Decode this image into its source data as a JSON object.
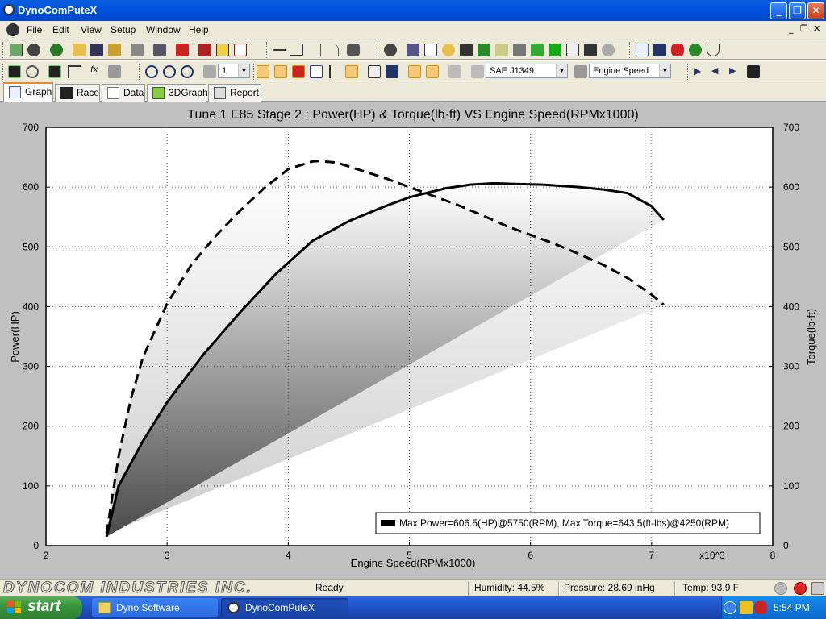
{
  "window": {
    "title": "DynoComPuteX"
  },
  "menu": {
    "items": [
      "File",
      "Edit",
      "View",
      "Setup",
      "Window",
      "Help"
    ]
  },
  "toolbar2": {
    "zoom_value": "1",
    "standard": "SAE J1349",
    "x_axis": "Engine Speed"
  },
  "tabs": [
    {
      "label": "Graph"
    },
    {
      "label": "Race"
    },
    {
      "label": "Data"
    },
    {
      "label": "3DGraph"
    },
    {
      "label": "Report"
    }
  ],
  "colors": {
    "titlebar": "#0054e3",
    "taskbar": "#245edb",
    "start": "#3c963c",
    "graph_bg": "#c0c0c0",
    "plot_bg": "#ffffff"
  },
  "chart_data": {
    "type": "line",
    "title": "Tune 1 E85 Stage 2 : Power(HP) & Torque(lb·ft) VS Engine Speed(RPMx1000)",
    "xlabel": "Engine Speed(RPMx1000)",
    "ylabel_left": "Power(HP)",
    "ylabel_right": "Torque(lb·ft)",
    "x_multiplier_label": "x10^3",
    "xlim": [
      2,
      8
    ],
    "ylim": [
      0,
      700
    ],
    "x_ticks": [
      "2",
      "3",
      "4",
      "5",
      "6",
      "7",
      "8"
    ],
    "y_ticks": [
      "0",
      "100",
      "200",
      "300",
      "400",
      "500",
      "600",
      "700"
    ],
    "grid": true,
    "legend_text": "Max Power=606.5(HP)@5750(RPM), Max Torque=643.5(ft-lbs)@4250(RPM)",
    "legend_placement": "bottom-right",
    "series": [
      {
        "name": "Power",
        "style": "solid",
        "x": [
          2.5,
          2.6,
          2.8,
          3.0,
          3.3,
          3.6,
          3.9,
          4.2,
          4.5,
          4.8,
          5.0,
          5.3,
          5.5,
          5.7,
          5.9,
          6.1,
          6.4,
          6.6,
          6.8,
          7.0,
          7.1
        ],
        "y": [
          15,
          100,
          175,
          240,
          320,
          390,
          455,
          510,
          543,
          568,
          583,
          598,
          604,
          606.5,
          605,
          604,
          600,
          596,
          590,
          568,
          545
        ]
      },
      {
        "name": "Torque",
        "style": "dashed",
        "x": [
          2.5,
          2.6,
          2.7,
          2.8,
          3.0,
          3.2,
          3.4,
          3.6,
          3.8,
          4.0,
          4.2,
          4.25,
          4.4,
          4.6,
          4.8,
          5.0,
          5.2,
          5.4,
          5.6,
          5.8,
          6.0,
          6.2,
          6.4,
          6.6,
          6.8,
          7.0,
          7.1
        ],
        "y": [
          20,
          150,
          245,
          315,
          405,
          470,
          518,
          560,
          598,
          630,
          643,
          643.5,
          641,
          628,
          615,
          600,
          585,
          570,
          553,
          535,
          520,
          505,
          488,
          470,
          448,
          420,
          403
        ]
      }
    ]
  },
  "status": {
    "logo": "DYNOCOM INDUSTRIES INC.",
    "ready": "Ready",
    "humidity": "Humidity: 44.5%",
    "pressure": "Pressure: 28.69 inHg",
    "temp": "Temp: 93.9 F"
  },
  "taskbar": {
    "start": "start",
    "tasks": [
      "Dyno Software",
      "DynoComPuteX"
    ],
    "clock": "5:54 PM"
  }
}
